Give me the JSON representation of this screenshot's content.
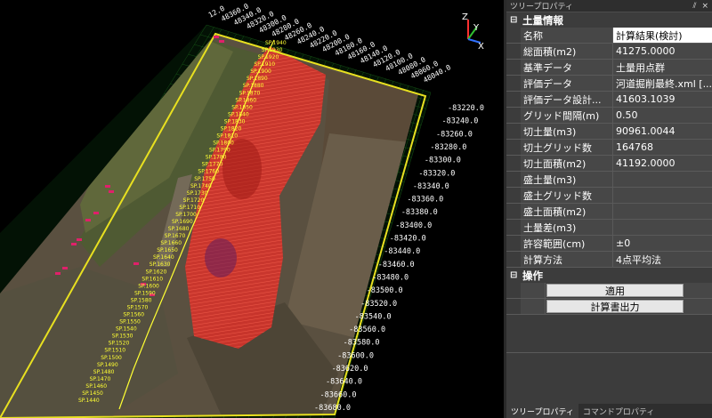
{
  "viewport": {
    "axis_labels": {
      "x": "X",
      "y": "Y",
      "z": "Z"
    },
    "top_labels": [
      "12.0",
      "48360.0",
      "48340.0",
      "48320.0",
      "48300.0",
      "48280.0",
      "48260.0",
      "48240.0",
      "48220.0",
      "48200.0",
      "48180.0",
      "48160.0",
      "48140.0",
      "48120.0",
      "48100.0",
      "48080.0",
      "48060.0",
      "48040.0"
    ],
    "right_labels": [
      "-83220.0",
      "-83240.0",
      "-83260.0",
      "-83280.0",
      "-83300.0",
      "-83320.0",
      "-83340.0",
      "-83360.0",
      "-83380.0",
      "-83400.0",
      "-83420.0",
      "-83440.0",
      "-83460.0",
      "-83480.0",
      "-83500.0",
      "-83520.0",
      "-83540.0",
      "-83560.0",
      "-83580.0",
      "-83600.0",
      "-83620.0",
      "-83640.0",
      "-83660.0",
      "-83680.0"
    ],
    "station_labels": [
      "SP.1440",
      "SP.1450",
      "SP.1460",
      "SP.1470",
      "SP.1480",
      "SP.1490",
      "SP.1500",
      "SP.1510",
      "SP.1520",
      "SP.1530",
      "SP.1540",
      "SP.1550",
      "SP.1560",
      "SP.1570",
      "SP.1580",
      "SP.1590",
      "SP.1600",
      "SP.1610",
      "SP.1620",
      "SP.1630",
      "SP.1640",
      "SP.1650",
      "SP.1660",
      "SP.1670",
      "SP.1680",
      "SP.1690",
      "SP.1700",
      "SP.1710",
      "SP.1720",
      "SP.1730",
      "SP.1740",
      "SP.1750",
      "SP.1760",
      "SP.1770",
      "SP.1780",
      "SP.1790",
      "SP.1800",
      "SP.1810",
      "SP.1820",
      "SP.1830",
      "SP.1840",
      "SP.1850",
      "SP.1860",
      "SP.1870",
      "SP.1880",
      "SP.1890",
      "SP.1900",
      "SP.1910",
      "SP.1920",
      "SP.1930",
      "SP.1940"
    ],
    "colors": {
      "grid": "#1e6e1e",
      "frame": "#e8e020",
      "cut": "#e8302a",
      "station": "#ffff33",
      "outlier": "#e0206a"
    }
  },
  "panel": {
    "title": "ツリープロパティ",
    "title_controls": {
      "pin": "⫽",
      "close": "×"
    },
    "section1": {
      "toggle": "⊟",
      "label": "土量情報"
    },
    "rows": [
      {
        "key": "名称",
        "value": "計算結果(検討)"
      },
      {
        "key": "総面積(m2)",
        "value": "41275.0000"
      },
      {
        "key": "基準データ",
        "value": "土量用点群"
      },
      {
        "key": "評価データ",
        "value": "河道掘削最終.xml [..."
      },
      {
        "key": "評価データ設計...",
        "value": "41603.1039"
      },
      {
        "key": "グリッド間隔(m)",
        "value": "0.50"
      },
      {
        "key": "切土量(m3)",
        "value": "90961.0044"
      },
      {
        "key": "切土グリッド数",
        "value": "164768"
      },
      {
        "key": "切土面積(m2)",
        "value": "41192.0000"
      },
      {
        "key": "盛土量(m3)",
        "value": ""
      },
      {
        "key": "盛土グリッド数",
        "value": ""
      },
      {
        "key": "盛土面積(m2)",
        "value": ""
      },
      {
        "key": "土量差(m3)",
        "value": ""
      },
      {
        "key": "許容範囲(cm)",
        "value": "±0"
      },
      {
        "key": "計算方法",
        "value": "4点平均法"
      }
    ],
    "section2": {
      "toggle": "⊟",
      "label": "操作"
    },
    "buttons": {
      "apply": "適用",
      "output": "計算書出力"
    },
    "tabs": {
      "tree": "ツリープロパティ",
      "command": "コマンドプロパティ"
    }
  }
}
